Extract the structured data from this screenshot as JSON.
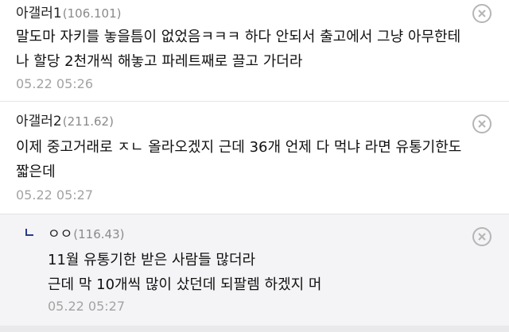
{
  "comments": [
    {
      "author": "아갤러1",
      "ip": "(106.101)",
      "lines": [
        "말도마 자키를 놓을틈이 없었음ㅋㅋㅋ 하다 안되서 출고에서 그냥 아무한테",
        "나 할당 2천개씩 해놓고 파레트째로 끌고 가더라"
      ],
      "time": "05.22 05:26",
      "delete_icon": "close-circle-icon"
    },
    {
      "author": "아갤러2",
      "ip": "(211.62)",
      "lines": [
        "이제 중고거래로 ㅈㄴ 올라오겠지 근데 36개 언제 다 먹냐 라면 유통기한도",
        "짧은데"
      ],
      "time": "05.22 05:27",
      "delete_icon": "close-circle-icon"
    },
    {
      "author": "ㅇㅇ",
      "ip": "(116.43)",
      "reply_icon": "reply-arrow-icon",
      "lines": [
        "11월 유통기한 받은 사람들 많더라",
        "근데 막 10개씩 많이 샀던데 되팔렘 하겠지 머"
      ],
      "time": "05.22 05:27",
      "delete_icon": "close-circle-icon"
    }
  ],
  "colors": {
    "reply_background": "#f4f4f6",
    "reply_mark": "#2b3a8c",
    "muted_text": "#a3a3a3"
  }
}
